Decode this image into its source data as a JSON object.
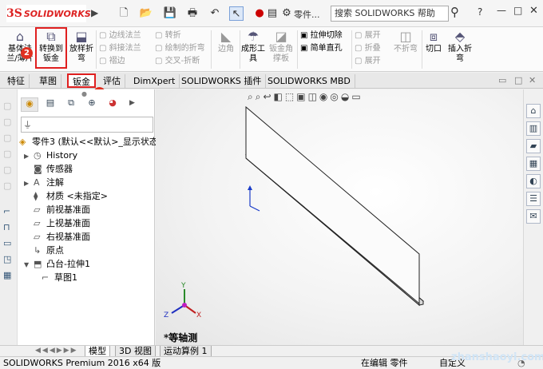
{
  "app": {
    "brand": "SOLIDWORKS",
    "part_label": "零件...",
    "search_placeholder": "搜索 SOLIDWORKS 帮助",
    "help": "?"
  },
  "ribbon": {
    "base_flange": "基体法兰/薄片",
    "convert_to_sheet": "转换到钣金",
    "lofted_bend": "放样折弯",
    "edge_flange": "边线法兰",
    "miter_flange": "斜接法兰",
    "hem": "褶边",
    "jog": "转折",
    "sketched_bend": "绘制的折弯",
    "cross_break": "交叉-折断",
    "corners": "边角",
    "forming_tool": "成形工具",
    "sheet_gusset": "钣金角撑板",
    "extruded_cut": "拉伸切除",
    "simple_hole": "简单直孔",
    "unfold": "展开",
    "fold": "折叠",
    "flatten": "展开",
    "no_bends": "不折弯",
    "rip": "切口",
    "insert_bends": "插入折弯",
    "badge1": "1",
    "badge2": "2"
  },
  "tabs": [
    "特征",
    "草图",
    "钣金",
    "评估",
    "DimXpert",
    "SOLIDWORKS 插件",
    "SOLIDWORKS MBD"
  ],
  "tree": [
    {
      "label": "零件3  (默认<<默认>_显示状态",
      "icon": "part"
    },
    {
      "label": "History",
      "icon": "history"
    },
    {
      "label": "传感器",
      "icon": "sensor"
    },
    {
      "label": "注解",
      "icon": "annotation"
    },
    {
      "label": "材质 <未指定>",
      "icon": "material"
    },
    {
      "label": "前视基准面",
      "icon": "plane"
    },
    {
      "label": "上视基准面",
      "icon": "plane"
    },
    {
      "label": "右视基准面",
      "icon": "plane"
    },
    {
      "label": "原点",
      "icon": "origin"
    },
    {
      "label": "凸台-拉伸1",
      "icon": "extrude"
    },
    {
      "label": "草图1",
      "icon": "sketch"
    }
  ],
  "viewport": {
    "view_name": "*等轴测",
    "axis_x": "X",
    "axis_y": "Y",
    "axis_z": "Z"
  },
  "bottom_tabs": [
    "模型",
    "3D 视图",
    "运动算例 1"
  ],
  "status": {
    "product": "SOLIDWORKS Premium 2016 x64 版",
    "editing": "在编辑 零件",
    "custom": "自定义"
  },
  "watermark": "zhanshaoyi.com",
  "colors": {
    "highlight_box": "#e02020",
    "badge": "#e03020",
    "brand": "#d22222"
  }
}
